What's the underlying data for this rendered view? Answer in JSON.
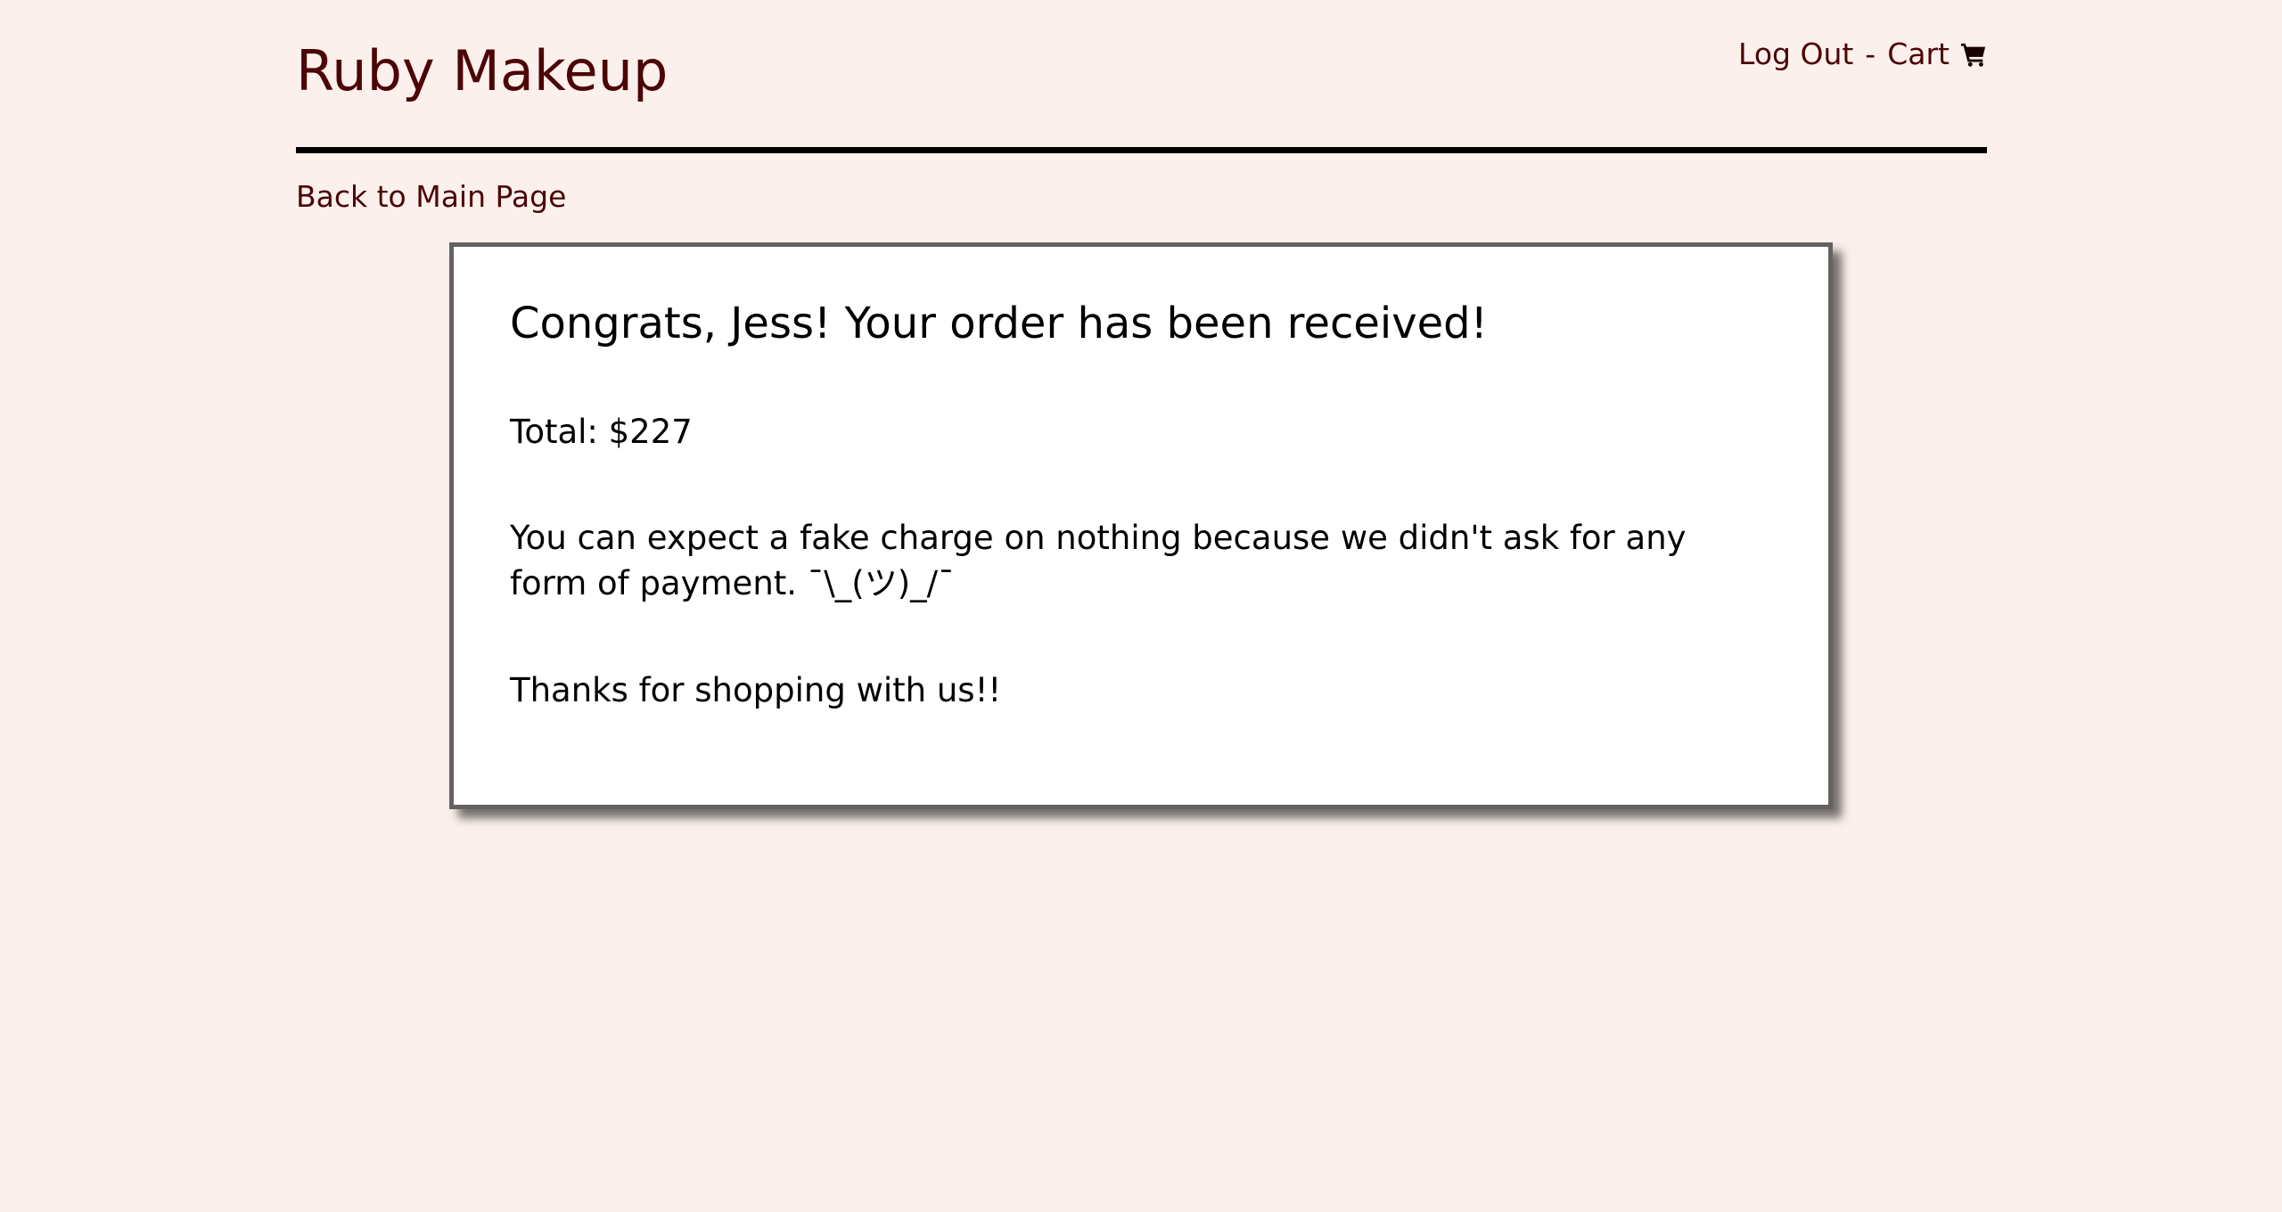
{
  "header": {
    "brand": "Ruby Makeup",
    "logout_label": "Log Out",
    "separator": "-",
    "cart_label": "Cart",
    "cart_icon": "shopping-cart-icon"
  },
  "nav": {
    "back_label": "Back to Main Page"
  },
  "confirmation": {
    "heading": "Congrats, Jess! Your order has been received!",
    "total": "Total: $227",
    "payment_note": "You can expect a fake charge on nothing because we didn't ask for any form of payment. ¯\\_(ツ)_/¯",
    "thanks": "Thanks for shopping with us!!"
  },
  "colors": {
    "background": "#fbf0ec",
    "brand": "#4d0407",
    "card_border": "#666262",
    "card_background": "#ffffff"
  }
}
